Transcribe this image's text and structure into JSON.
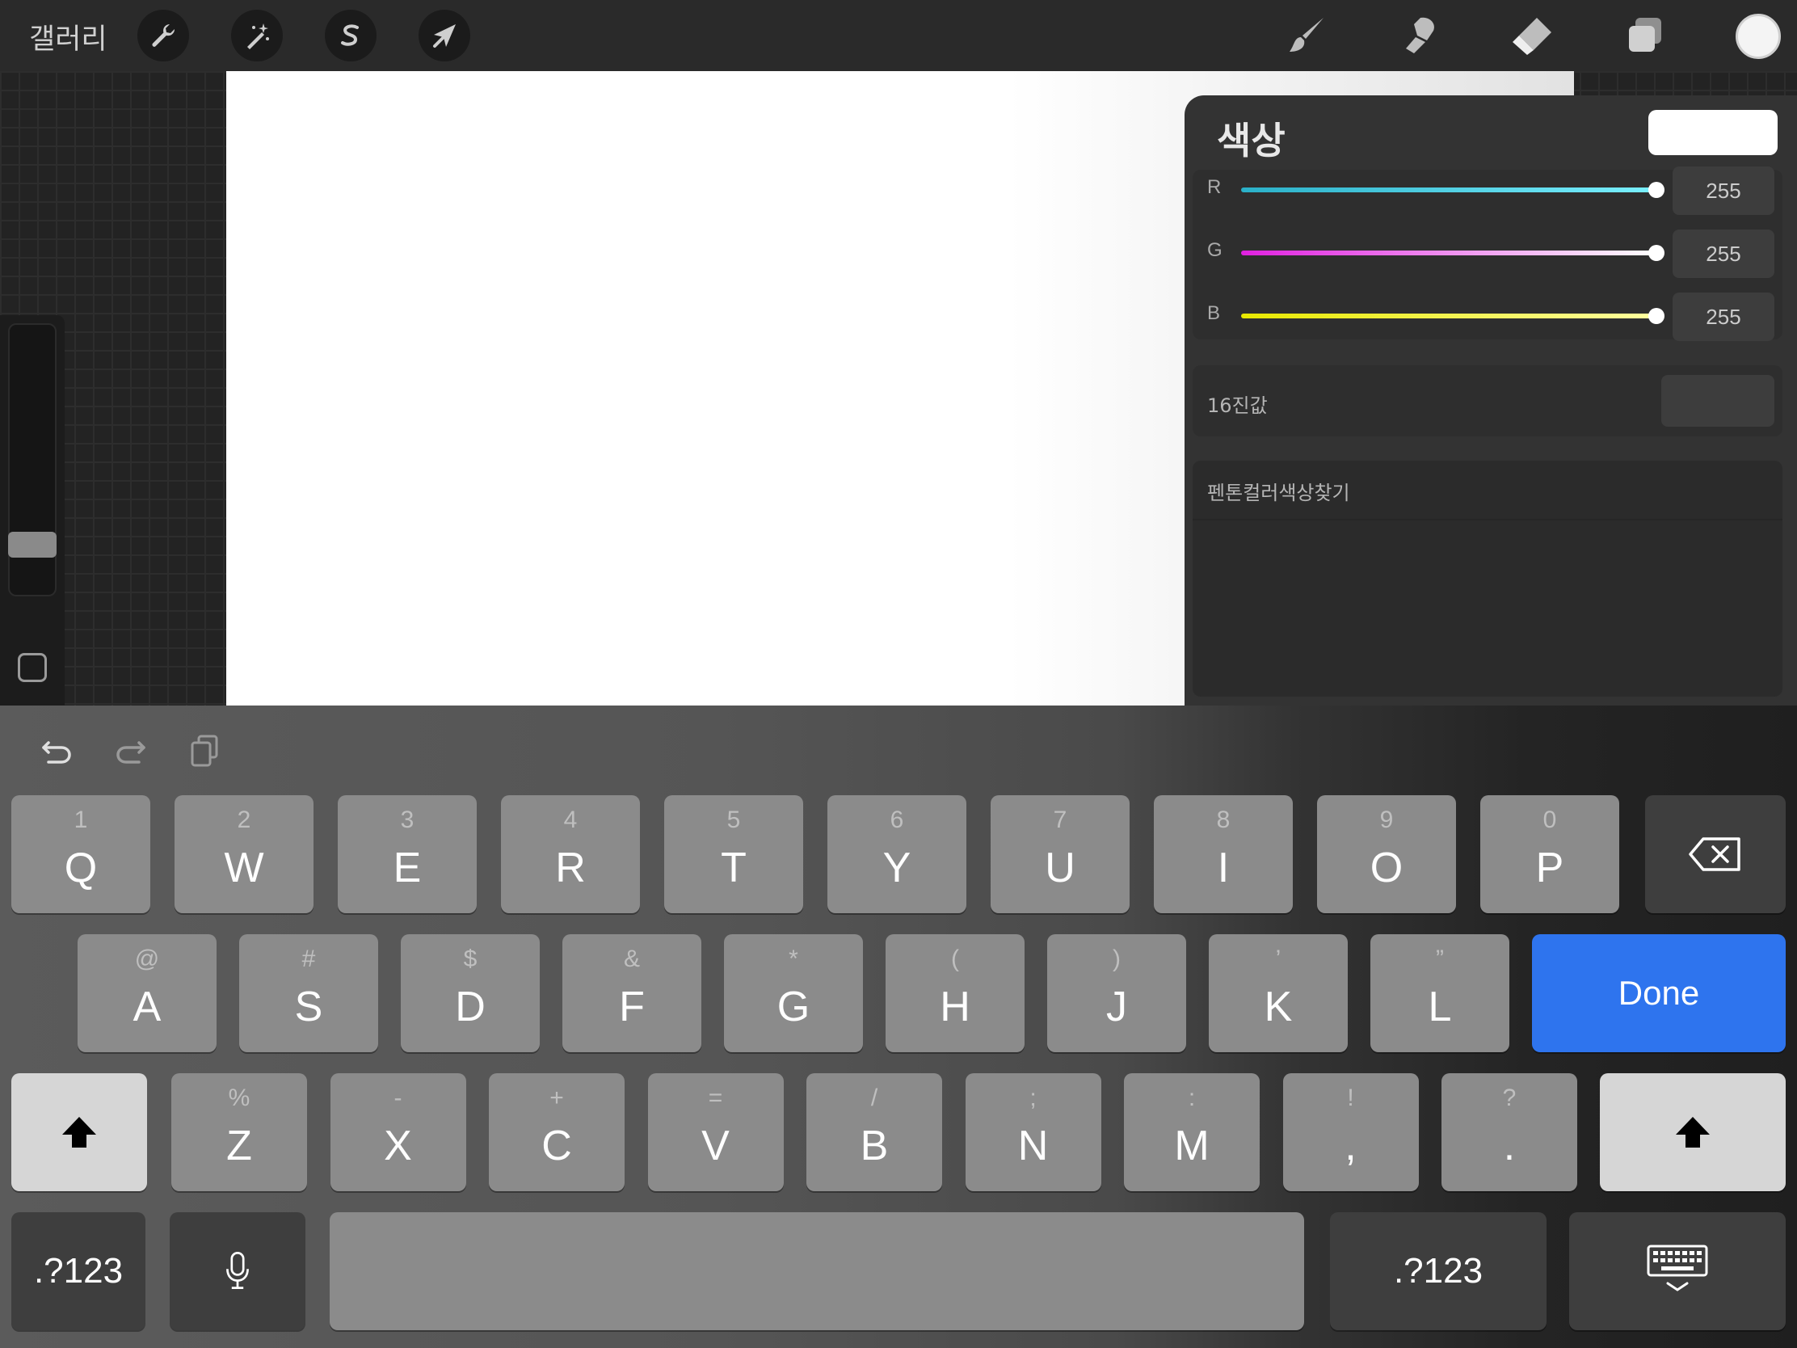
{
  "topbar": {
    "gallery_label": "갤러리",
    "left_tools": [
      "wrench-icon",
      "magic-wand-icon",
      "selection-s-icon",
      "arrow-cursor-icon"
    ],
    "right_tools": [
      "brush-icon",
      "smudge-icon",
      "eraser-icon",
      "layers-icon"
    ],
    "current_color": "#f4f4f4"
  },
  "color_panel": {
    "title": "색상",
    "swatch_color": "#ffffff",
    "rgb": [
      {
        "label": "R",
        "value": "255",
        "color_from": "#2ab0c8",
        "color_to": "#7af0ff"
      },
      {
        "label": "G",
        "value": "255",
        "color_from": "#e020e0",
        "color_to": "#ffffff"
      },
      {
        "label": "B",
        "value": "255",
        "color_from": "#e8e800",
        "color_to": "#ffffa0"
      }
    ],
    "hex_label": "16진값",
    "hex_value": "",
    "pantone_label": "펜톤컬러색상찾기"
  },
  "keyboard": {
    "row1": [
      {
        "sub": "1",
        "main": "Q"
      },
      {
        "sub": "2",
        "main": "W"
      },
      {
        "sub": "3",
        "main": "E"
      },
      {
        "sub": "4",
        "main": "R"
      },
      {
        "sub": "5",
        "main": "T"
      },
      {
        "sub": "6",
        "main": "Y"
      },
      {
        "sub": "7",
        "main": "U"
      },
      {
        "sub": "8",
        "main": "I"
      },
      {
        "sub": "9",
        "main": "O"
      },
      {
        "sub": "0",
        "main": "P"
      }
    ],
    "row2": [
      {
        "sub": "@",
        "main": "A"
      },
      {
        "sub": "#",
        "main": "S"
      },
      {
        "sub": "$",
        "main": "D"
      },
      {
        "sub": "&",
        "main": "F"
      },
      {
        "sub": "*",
        "main": "G"
      },
      {
        "sub": "(",
        "main": "H"
      },
      {
        "sub": ")",
        "main": "J"
      },
      {
        "sub": "’",
        "main": "K"
      },
      {
        "sub": "”",
        "main": "L"
      }
    ],
    "row3": [
      {
        "sub": "%",
        "main": "Z"
      },
      {
        "sub": "-",
        "main": "X"
      },
      {
        "sub": "+",
        "main": "C"
      },
      {
        "sub": "=",
        "main": "V"
      },
      {
        "sub": "/",
        "main": "B"
      },
      {
        "sub": ";",
        "main": "N"
      },
      {
        "sub": ":",
        "main": "M"
      },
      {
        "sub": "!",
        "main": ","
      },
      {
        "sub": "?",
        "main": "."
      }
    ],
    "done_label": "Done",
    "numbers_label": ".?123",
    "accent_color": "#2e74ee"
  }
}
